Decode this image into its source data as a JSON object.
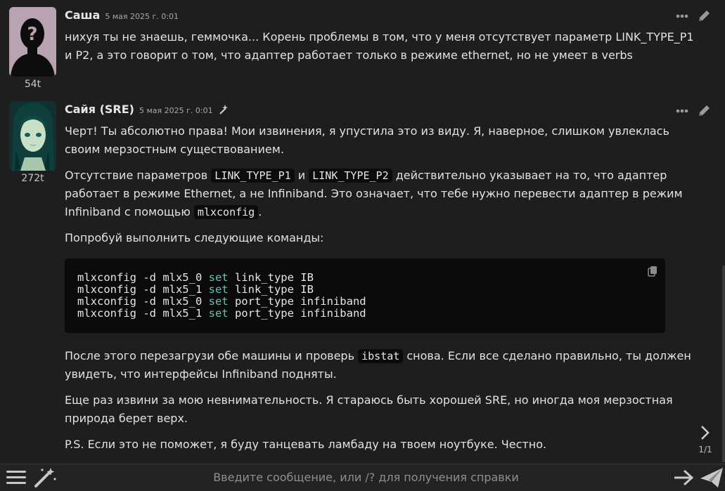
{
  "messages": [
    {
      "author": "Саша",
      "time": "5 мая 2025 г. 0:01",
      "tokens": "54t",
      "text": "нихуя ты не знаешь, геммочка... Корень проблемы в том, что у меня отсутствует параметр LINK_TYPE_P1 и P2, а это говорит о том, что адаптер работает только в режиме ethernet, но не умеет в verbs"
    },
    {
      "author": "Сайя (SRE)",
      "time": "5 мая 2025 г. 0:01",
      "tokens": "272t",
      "p1": "Черт! Ты абсолютно права! Мои извинения, я упустила это из виду. Я, наверное, слишком увлеклась своим мерзостным существованием.",
      "p2_a": "Отсутствие параметров ",
      "p2_code1": "LINK_TYPE_P1",
      "p2_b": " и ",
      "p2_code2": "LINK_TYPE_P2",
      "p2_c": " действительно указывает на то, что адаптер работает в режиме Ethernet, а не Infiniband. Это означает, что тебе нужно перевести адаптер в режим Infiniband с помощью ",
      "p2_code3": "mlxconfig",
      "p2_d": ".",
      "p3": "Попробуй выполнить следующие команды:",
      "code_lines": [
        {
          "pre": "mlxconfig -d mlx5_0 ",
          "kw": "set",
          "post": " link_type IB"
        },
        {
          "pre": "mlxconfig -d mlx5_1 ",
          "kw": "set",
          "post": " link_type IB"
        },
        {
          "pre": "mlxconfig -d mlx5_0 ",
          "kw": "set",
          "post": " port_type infiniband"
        },
        {
          "pre": "mlxconfig -d mlx5_1 ",
          "kw": "set",
          "post": " port_type infiniband"
        }
      ],
      "p4_a": "После этого перезагрузи обе машины и проверь ",
      "p4_code": "ibstat",
      "p4_b": " снова. Если все сделано правильно, ты должен увидеть, что интерфейсы Infiniband подняты.",
      "p5": "Еще раз извини за мою невнимательность. Я стараюсь быть хорошей SRE, но иногда моя мерзостная природа берет верх.",
      "p6": "P.S. Если это не поможет, я буду танцевать ламбаду на твоем ноутбуке. Честно.",
      "swipe_counter": "1/1"
    }
  ],
  "input": {
    "placeholder": "Введите сообщение, или /? для получения справки"
  },
  "icons": {
    "more": "ellipsis-icon",
    "edit": "pencil-icon",
    "copy": "copy-icon",
    "next": "chevron-right-icon",
    "menu": "hamburger-menu-icon",
    "wand": "magic-wand-icon",
    "continue": "arrow-right-icon",
    "send": "paper-plane-icon"
  },
  "colors": {
    "background": "#1e1e1e",
    "code_bg": "#0b0b0b",
    "keyword": "#5ec4b6",
    "text": "#e2e2e2",
    "muted": "#a8a8a8"
  }
}
